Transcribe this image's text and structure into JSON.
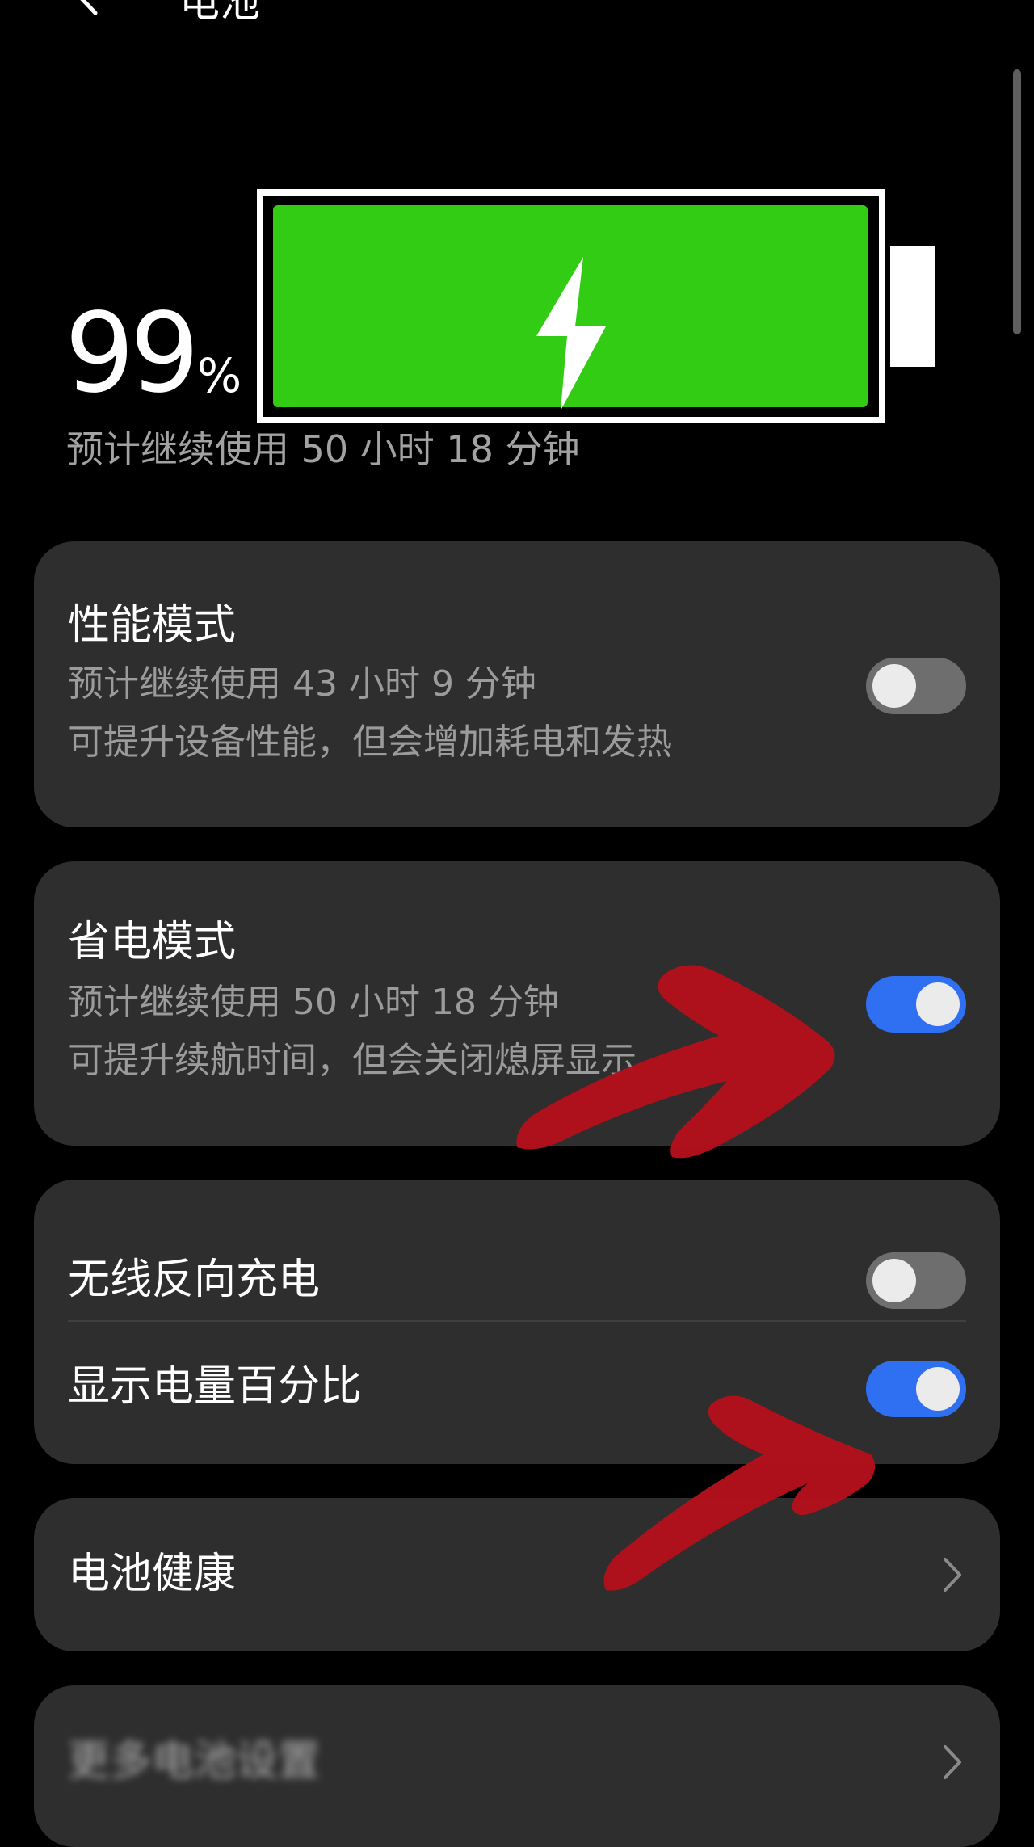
{
  "header": {
    "title": "电池",
    "back_icon": "back-arrow-icon"
  },
  "battery": {
    "percent": "99",
    "percent_sign": "%",
    "level": 0.99,
    "charging": true,
    "fill_color": "#33cc14",
    "estimate": "预计继续使用 50 小时 18 分钟"
  },
  "performance_mode": {
    "title": "性能模式",
    "estimate": "预计继续使用 43 小时 9 分钟",
    "description": "可提升设备性能，但会增加耗电和发热",
    "enabled": false
  },
  "power_saving_mode": {
    "title": "省电模式",
    "estimate": "预计继续使用 50 小时 18 分钟",
    "description": "可提升续航时间，但会关闭熄屏显示",
    "enabled": true
  },
  "wireless_reverse_charging": {
    "title": "无线反向充电",
    "enabled": false
  },
  "show_battery_percentage": {
    "title": "显示电量百分比",
    "enabled": true
  },
  "battery_health": {
    "title": "电池健康",
    "icon": "chevron-right-icon"
  },
  "more_settings": {
    "title": "更多电池设置",
    "icon": "chevron-right-icon"
  },
  "colors": {
    "background": "#000000",
    "card": "#2e2e2e",
    "toggle_on": "#2f6ff2",
    "toggle_off": "#6e6e6e",
    "annotation_arrow": "#b3111c"
  }
}
